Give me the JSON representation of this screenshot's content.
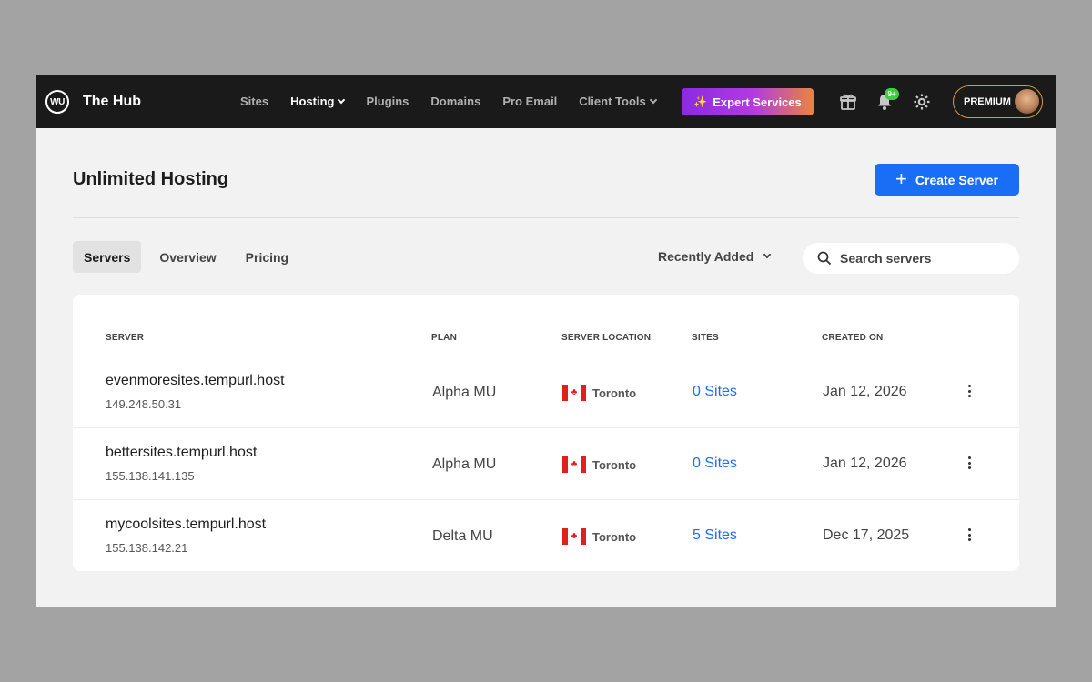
{
  "brand": {
    "logo_text": "WU",
    "name": "The Hub"
  },
  "nav": {
    "items": [
      {
        "label": "Sites"
      },
      {
        "label": "Hosting"
      },
      {
        "label": "Plugins"
      },
      {
        "label": "Domains"
      },
      {
        "label": "Pro Email"
      },
      {
        "label": "Client Tools"
      }
    ],
    "active": "Hosting",
    "expert_services": "Expert Services",
    "notification_badge": "9+",
    "premium_label": "PREMIUM"
  },
  "page": {
    "title": "Unlimited Hosting",
    "create_button": "Create Server"
  },
  "tabs": [
    {
      "label": "Servers"
    },
    {
      "label": "Overview"
    },
    {
      "label": "Pricing"
    }
  ],
  "active_tab": "Servers",
  "sort": {
    "label": "Recently Added"
  },
  "search": {
    "placeholder": "Search servers"
  },
  "table": {
    "headers": {
      "server": "SERVER",
      "plan": "PLAN",
      "location": "SERVER LOCATION",
      "sites": "SITES",
      "created": "CREATED ON"
    },
    "rows": [
      {
        "name": "evenmoresites.tempurl.host",
        "ip": "149.248.50.31",
        "plan": "Alpha MU",
        "location": "Toronto",
        "sites": "0 Sites",
        "created": "Jan 12, 2026"
      },
      {
        "name": "bettersites.tempurl.host",
        "ip": "155.138.141.135",
        "plan": "Alpha MU",
        "location": "Toronto",
        "sites": "0 Sites",
        "created": "Jan 12, 2026"
      },
      {
        "name": "mycoolsites.tempurl.host",
        "ip": "155.138.142.21",
        "plan": "Delta MU",
        "location": "Toronto",
        "sites": "5 Sites",
        "created": "Dec 17, 2025"
      }
    ]
  },
  "colors": {
    "accent": "#1a6ef5",
    "nav_bg": "#1a1a1a",
    "badge": "#3ecf3e",
    "premium_border": "#d89a3a"
  },
  "icons": [
    "gift-icon",
    "bell-icon",
    "gear-icon",
    "search-icon",
    "plus-icon",
    "magic-wand-icon",
    "canada-flag-icon",
    "more-vertical-icon"
  ]
}
